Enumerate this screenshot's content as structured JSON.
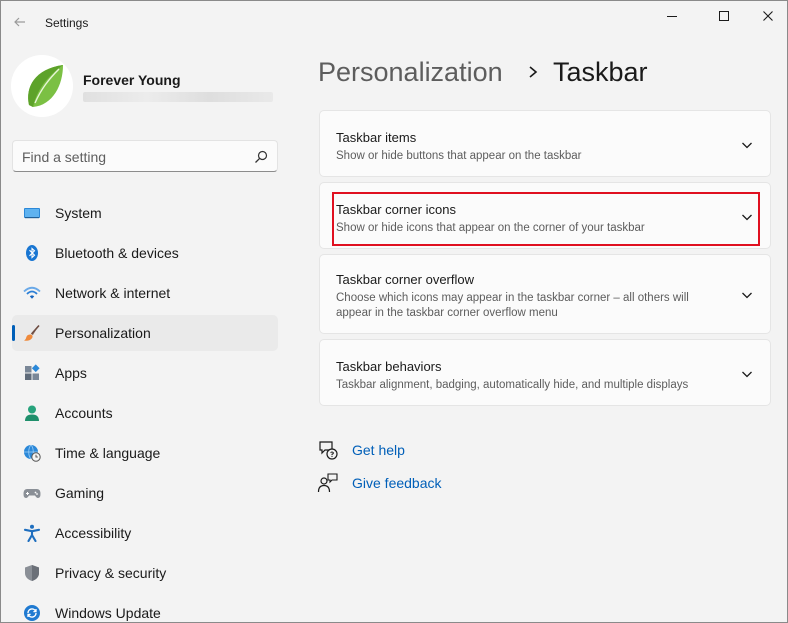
{
  "window": {
    "title": "Settings",
    "controls": [
      "minimize",
      "maximize",
      "close"
    ]
  },
  "profile": {
    "name": "Forever Young"
  },
  "search": {
    "placeholder": "Find a setting"
  },
  "nav": {
    "items": [
      {
        "label": "System",
        "icon": "monitor-icon"
      },
      {
        "label": "Bluetooth & devices",
        "icon": "bluetooth-icon"
      },
      {
        "label": "Network & internet",
        "icon": "wifi-icon"
      },
      {
        "label": "Personalization",
        "icon": "brush-icon",
        "active": true
      },
      {
        "label": "Apps",
        "icon": "apps-icon"
      },
      {
        "label": "Accounts",
        "icon": "person-icon"
      },
      {
        "label": "Time & language",
        "icon": "globe-clock-icon"
      },
      {
        "label": "Gaming",
        "icon": "gamepad-icon"
      },
      {
        "label": "Accessibility",
        "icon": "accessibility-icon"
      },
      {
        "label": "Privacy & security",
        "icon": "shield-icon"
      },
      {
        "label": "Windows Update",
        "icon": "update-icon"
      }
    ]
  },
  "breadcrumb": {
    "parent": "Personalization",
    "current": "Taskbar"
  },
  "cards": [
    {
      "title": "Taskbar items",
      "desc": "Show or hide buttons that appear on the taskbar"
    },
    {
      "title": "Taskbar corner icons",
      "desc": "Show or hide icons that appear on the corner of your taskbar",
      "highlighted": true
    },
    {
      "title": "Taskbar corner overflow",
      "desc_line1": "Choose which icons may appear in the taskbar corner – all others will",
      "desc_line2": "appear in the taskbar corner overflow menu"
    },
    {
      "title": "Taskbar behaviors",
      "desc": "Taskbar alignment, badging, automatically hide, and multiple displays"
    }
  ],
  "links": {
    "help": "Get help",
    "feedback": "Give feedback"
  },
  "colors": {
    "accent": "#005fb8",
    "highlight": "#e01020",
    "background": "#f3f3f3",
    "card": "#fbfbfb"
  }
}
